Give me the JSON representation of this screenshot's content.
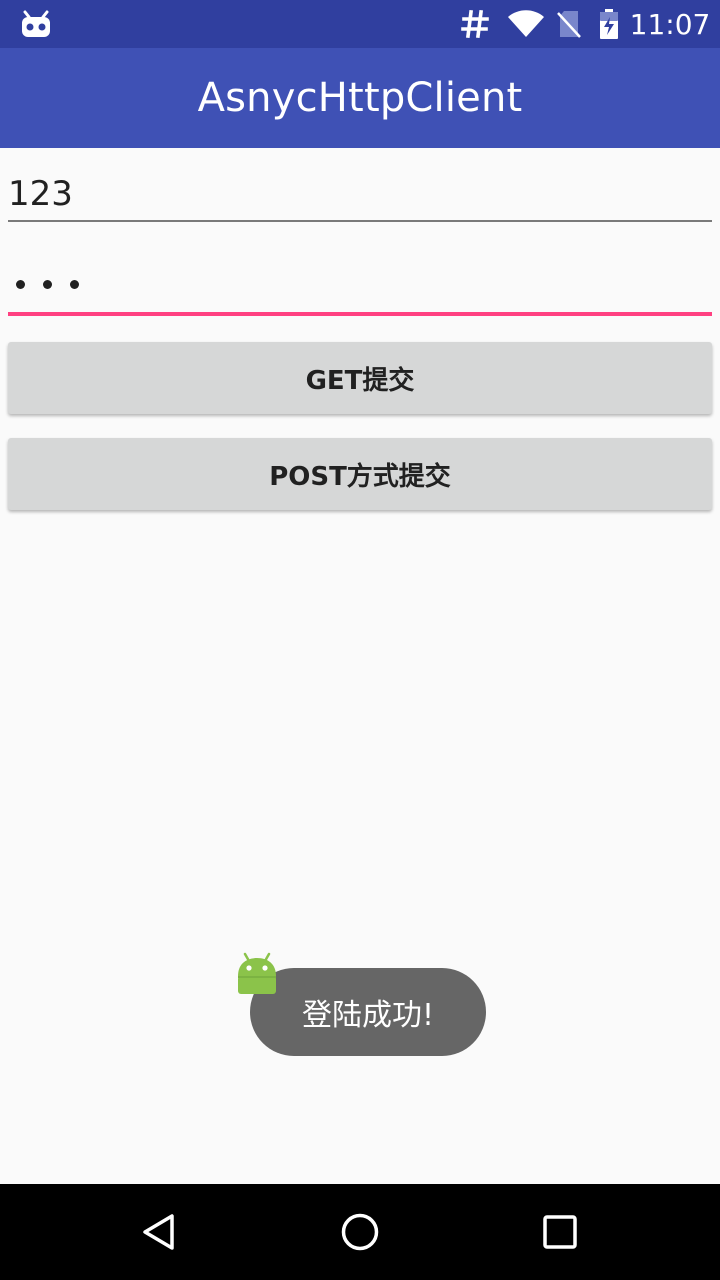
{
  "status_bar": {
    "time": "11:07",
    "icons": [
      "debug-robot-icon",
      "hash-icon",
      "wifi-icon",
      "no-sim-icon",
      "battery-charging-icon"
    ]
  },
  "app_bar": {
    "title": "AsnycHttpClient"
  },
  "form": {
    "username_value": "123",
    "password_mask_count": 3,
    "password_focus_color": "#ff4081"
  },
  "buttons": {
    "get_label": "GET提交",
    "post_label": "POST方式提交"
  },
  "toast": {
    "message": "登陆成功!",
    "icon": "android-robot-icon"
  },
  "nav_bar": {
    "icons": [
      "back-icon",
      "home-icon",
      "recents-icon"
    ]
  },
  "colors": {
    "status_bar": "#303f9f",
    "app_bar": "#3f51b5",
    "accent": "#ff4081",
    "button": "#d6d7d7",
    "toast": "#666666"
  }
}
